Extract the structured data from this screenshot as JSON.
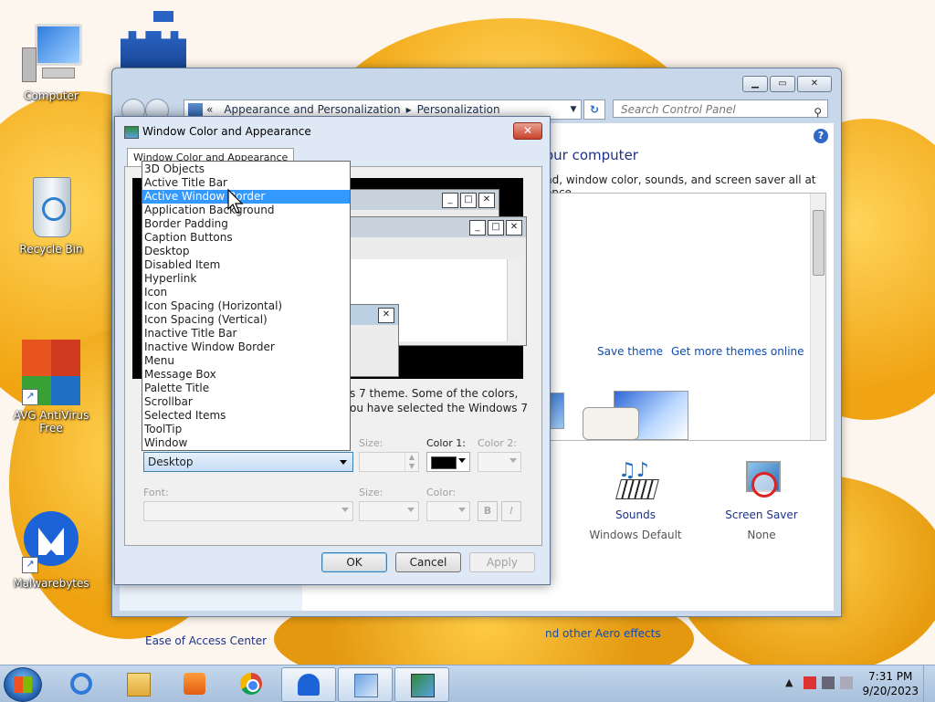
{
  "desktop": {
    "icons": [
      {
        "label": "Computer",
        "icon": "computer-icon"
      },
      {
        "label": "Recycle Bin",
        "icon": "recycle-bin-icon"
      },
      {
        "label": "AVG AntiVirus Free",
        "icon": "avg-antivirus-icon"
      },
      {
        "label": "Malwarebytes",
        "icon": "malwarebytes-icon"
      }
    ]
  },
  "control_panel": {
    "breadcrumb_prefix": "«",
    "breadcrumb": [
      "Appearance and Personalization",
      "Personalization"
    ],
    "search_placeholder": "Search Control Panel",
    "heading": "our computer",
    "subtitle": "nd, window color, sounds, and screen saver all at once.",
    "links": {
      "save_theme": "Save theme",
      "get_more": "Get more themes online"
    },
    "sounds": {
      "title": "Sounds",
      "value": "Windows Default"
    },
    "screen_saver": {
      "title": "Screen Saver",
      "value": "None"
    },
    "aero_link": "nd other Aero effects",
    "ease_link": "Ease of Access Center"
  },
  "dialog": {
    "title": "Window Color and Appearance",
    "tab": "Window Color and Appearance",
    "description_line1": "s 7 theme.  Some of the colors,",
    "description_line2": "ou have selected the Windows 7",
    "item_value": "Desktop",
    "labels": {
      "size": "Size:",
      "color1": "Color 1:",
      "color2": "Color 2:",
      "font": "Font:",
      "font_size": "Size:",
      "font_color": "Color:",
      "bold": "B",
      "italic": "I"
    },
    "color1_value": "#000000",
    "buttons": {
      "ok": "OK",
      "cancel": "Cancel",
      "apply": "Apply"
    },
    "dropdown_options": [
      "3D Objects",
      "Active Title Bar",
      "Active Window Border",
      "Application Background",
      "Border Padding",
      "Caption Buttons",
      "Desktop",
      "Disabled Item",
      "Hyperlink",
      "Icon",
      "Icon Spacing (Horizontal)",
      "Icon Spacing (Vertical)",
      "Inactive Title Bar",
      "Inactive Window Border",
      "Menu",
      "Message Box",
      "Palette Title",
      "Scrollbar",
      "Selected Items",
      "ToolTip",
      "Window"
    ],
    "highlighted_option": "Active Window Border"
  },
  "taskbar": {
    "apps": [
      "internet-explorer-icon",
      "file-explorer-icon",
      "media-player-icon",
      "chrome-icon",
      "malwarebytes-taskbar-icon",
      "control-panel-icon",
      "personalization-icon"
    ],
    "time": "7:31 PM",
    "date": "9/20/2023"
  }
}
